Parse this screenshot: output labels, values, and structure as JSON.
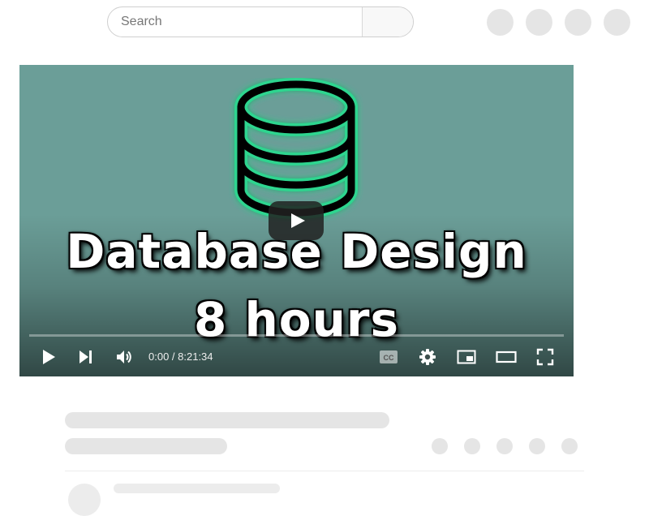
{
  "search": {
    "placeholder": "Search"
  },
  "header": {
    "icons": [
      "account-icon",
      "notifications-icon",
      "apps-icon",
      "avatar-icon"
    ]
  },
  "video": {
    "thumbnail_title_line1": "Database Design",
    "thumbnail_title_line2": "8 hours",
    "time_display": "0:00 / 8:21:34",
    "progress_fraction": 0,
    "accent_color": "#2fd58f",
    "background_color": "#6b9e98"
  },
  "controls": {
    "icons": [
      "play-icon",
      "next-icon",
      "volume-icon",
      "captions-icon",
      "settings-icon",
      "miniplayer-icon",
      "theater-icon",
      "fullscreen-icon"
    ]
  }
}
